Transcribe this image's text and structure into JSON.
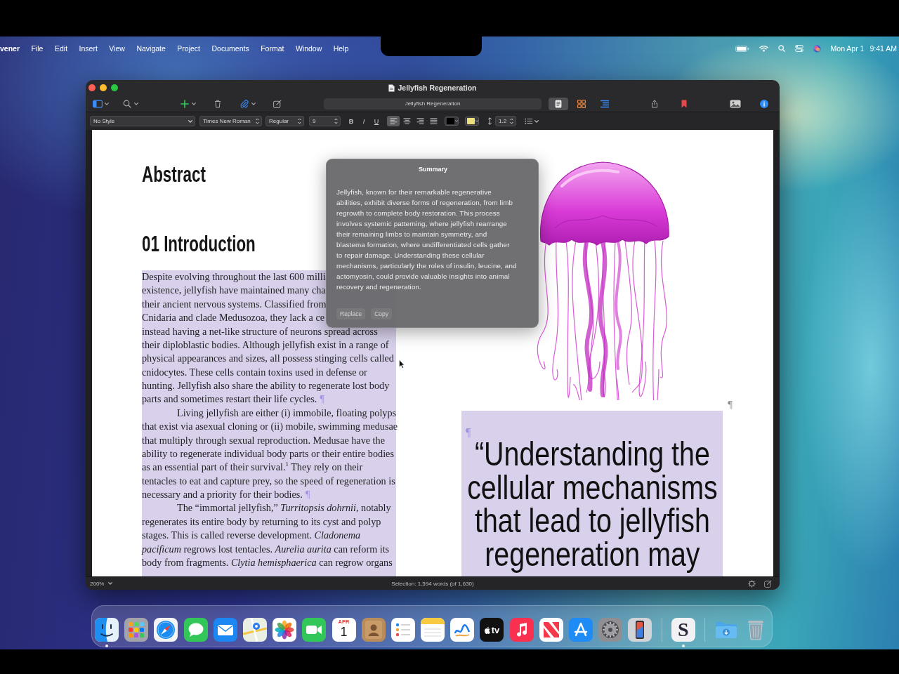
{
  "menu_bar": {
    "app_name": "vener",
    "items": [
      "File",
      "Edit",
      "Insert",
      "View",
      "Navigate",
      "Project",
      "Documents",
      "Format",
      "Window",
      "Help"
    ],
    "date": "Mon Apr 1",
    "time": "9:41 AM"
  },
  "window": {
    "title": "Jellyfish Regeneration",
    "toolbar": {
      "document_title": "Jellyfish Regeneration",
      "view_modes": [
        {
          "kind": "document",
          "selected": true
        },
        {
          "kind": "corkboard",
          "selected": false
        },
        {
          "kind": "outline",
          "selected": false
        }
      ]
    },
    "format_bar": {
      "paragraph_style": "No Style",
      "font_family": "Times New Roman",
      "font_style": "Regular",
      "font_size": "9",
      "style_buttons": [
        {
          "kind": "bold",
          "label": "B"
        },
        {
          "kind": "italic",
          "label": "I"
        },
        {
          "kind": "underline",
          "label": "U"
        }
      ],
      "alignments": [
        {
          "kind": "left",
          "selected": true
        },
        {
          "kind": "center",
          "selected": false
        },
        {
          "kind": "right",
          "selected": false
        },
        {
          "kind": "justify",
          "selected": false
        }
      ],
      "color_wells": [
        {
          "kind": "text",
          "color": "#000000"
        },
        {
          "kind": "highlight",
          "color": "#ece07a"
        }
      ],
      "line_spacing": "1.2"
    },
    "document": {
      "headings": [
        "Abstract",
        "01 Introduction"
      ],
      "body": {
        "selected": true,
        "paragraphs": [
          {
            "indent": false,
            "covered_lines": [
              "Despite evolving throughout the last 600 milli",
              "existence, jellyfish have maintained many cha",
              "their ancient nervous systems. Classified from",
              "Cnidaria and clade Medusozoa, they lack a ce"
            ],
            "lines": [
              "instead having a net-like structure of neurons spread across",
              "their diploblastic bodies. Although jellyfish exist in a range of",
              "physical appearances and sizes, all possess stinging cells called",
              "cnidocytes. These cells contain toxins used in defense or",
              "hunting. Jellyfish also share the ability to regenerate lost body",
              "parts and sometimes restart their life cycles."
            ],
            "mark": "¶"
          },
          {
            "indent": true,
            "lines": [
              "Living jellyfish are either (i) immobile, floating polyps",
              "that exist via asexual cloning or (ii) mobile, swimming medusae",
              "that multiply through sexual reproduction. Medusae have the",
              "ability to regenerate individual body parts or their entire bodies",
              "as an essential part of their survival.$^{1}$ They rely on their",
              "tentacles to eat and capture prey, so the speed of regeneration is",
              "necessary and a priority for their bodies."
            ],
            "mark": "¶"
          },
          {
            "indent": true,
            "lines": [
              "The “immortal jellyfish,” *Turritopsis dohrnii*, notably",
              "regenerates its entire body by returning to its cyst and polyp",
              "stages. This is called reverse development. *Cladonema*",
              "*pacificum* regrows lost tentacles. *Aurelia aurita* can reform its",
              "body from fragments. *Clytia hemisphaerica* can regrow organs"
            ]
          }
        ]
      },
      "image_mark": "¶",
      "pull_quote": {
        "selected": true,
        "mark": "¶",
        "lines": [
          "“Understanding the",
          "cellular mechanisms",
          "that lead to jellyfish",
          "regeneration may"
        ]
      }
    },
    "summary_popup": {
      "title": "Summary",
      "lines": [
        "Jellyfish, known for their remarkable regenerative",
        "abilities, exhibit diverse forms of regeneration, from limb",
        "regrowth to complete body restoration. This process",
        "involves systemic patterning, where jellyfish rearrange",
        "their remaining limbs to maintain symmetry, and",
        "blastema formation, where undifferentiated cells gather",
        "to repair damage. Understanding these cellular",
        "mechanisms, particularly the roles of insulin, leucine, and",
        "actomyosin, could provide valuable insights into animal",
        "recovery and regeneration."
      ],
      "buttons": [
        {
          "label": "Replace",
          "disabled": true
        },
        {
          "label": "Copy",
          "disabled": true
        }
      ]
    },
    "status_bar": {
      "zoom": "200%",
      "selection": "Selection: 1,594 words (of 1,630)"
    }
  },
  "dock": {
    "apps": [
      {
        "kind": "face",
        "running": true
      },
      {
        "kind": "app_grid",
        "running": false
      },
      {
        "kind": "compass",
        "running": false
      },
      {
        "kind": "speech_bubble",
        "running": false
      },
      {
        "kind": "envelope",
        "running": false
      },
      {
        "kind": "map",
        "running": false
      },
      {
        "kind": "flower",
        "running": false
      },
      {
        "kind": "video_camera",
        "running": false
      },
      {
        "kind": "calendar",
        "month": "APR",
        "day": "1",
        "running": false
      },
      {
        "kind": "address_book",
        "running": false
      },
      {
        "kind": "checklist",
        "running": false
      },
      {
        "kind": "notepad",
        "running": false
      },
      {
        "kind": "scribble",
        "running": false
      },
      {
        "kind": "tv",
        "label": "tv",
        "running": false
      },
      {
        "kind": "music_note",
        "running": false
      },
      {
        "kind": "news",
        "running": false
      },
      {
        "kind": "app_store",
        "running": false
      },
      {
        "kind": "gear",
        "running": false
      },
      {
        "kind": "phone",
        "running": false
      }
    ],
    "recent_apps": [
      {
        "kind": "letter",
        "label": "S",
        "running": true
      }
    ],
    "stacks": [
      {
        "kind": "folder"
      },
      {
        "kind": "trash"
      }
    ]
  }
}
